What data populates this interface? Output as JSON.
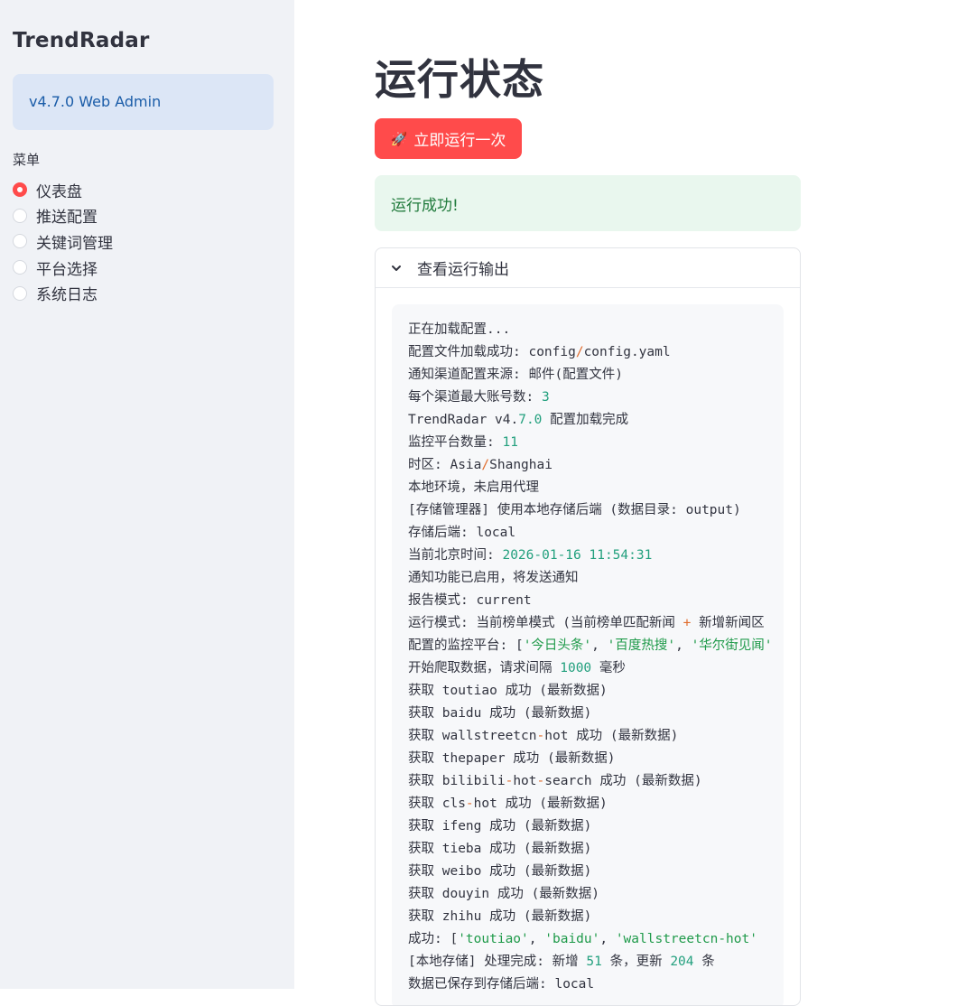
{
  "sidebar": {
    "brand": "TrendRadar",
    "version": "v4.7.0 Web Admin",
    "menu_label": "菜单",
    "items": [
      {
        "label": "仪表盘",
        "selected": true
      },
      {
        "label": "推送配置",
        "selected": false
      },
      {
        "label": "关键词管理",
        "selected": false
      },
      {
        "label": "平台选择",
        "selected": false
      },
      {
        "label": "系统日志",
        "selected": false
      }
    ]
  },
  "main": {
    "title": "运行状态",
    "run_button": {
      "icon": "rocket-icon",
      "label": "立即运行一次"
    },
    "success_message": "运行成功!",
    "expander_title": "查看运行输出",
    "output_lines": [
      [
        [
          "t",
          "正在加载配置..."
        ]
      ],
      [
        [
          "t",
          "配置文件加载成功: config"
        ],
        [
          "o",
          "/"
        ],
        [
          "t",
          "config.yaml"
        ]
      ],
      [
        [
          "t",
          "通知渠道配置来源: 邮件(配置文件)"
        ]
      ],
      [
        [
          "t",
          "每个渠道最大账号数: "
        ],
        [
          "n",
          "3"
        ]
      ],
      [
        [
          "t",
          "TrendRadar v4."
        ],
        [
          "n",
          "7.0"
        ],
        [
          "t",
          " 配置加载完成"
        ]
      ],
      [
        [
          "t",
          "监控平台数量: "
        ],
        [
          "n",
          "11"
        ]
      ],
      [
        [
          "t",
          "时区: Asia"
        ],
        [
          "o",
          "/"
        ],
        [
          "t",
          "Shanghai"
        ]
      ],
      [
        [
          "t",
          "本地环境，未启用代理"
        ]
      ],
      [
        [
          "t",
          "[存储管理器] 使用本地存储后端 (数据目录: output)"
        ]
      ],
      [
        [
          "t",
          "存储后端: local"
        ]
      ],
      [
        [
          "t",
          "当前北京时间: "
        ],
        [
          "n",
          "2026-01-16 11:54:31"
        ]
      ],
      [
        [
          "t",
          "通知功能已启用，将发送通知"
        ]
      ],
      [
        [
          "t",
          "报告模式: current"
        ]
      ],
      [
        [
          "t",
          "运行模式: 当前榜单模式 (当前榜单匹配新闻 "
        ],
        [
          "o",
          "+"
        ],
        [
          "t",
          " 新增新闻区"
        ]
      ],
      [
        [
          "t",
          "配置的监控平台: ["
        ],
        [
          "s",
          "'今日头条'"
        ],
        [
          "t",
          ", "
        ],
        [
          "s",
          "'百度热搜'"
        ],
        [
          "t",
          ", "
        ],
        [
          "s",
          "'华尔街见闻'"
        ]
      ],
      [
        [
          "t",
          "开始爬取数据，请求间隔 "
        ],
        [
          "n",
          "1000"
        ],
        [
          "t",
          " 毫秒"
        ]
      ],
      [
        [
          "t",
          "获取 toutiao 成功 (最新数据)"
        ]
      ],
      [
        [
          "t",
          "获取 baidu 成功 (最新数据)"
        ]
      ],
      [
        [
          "t",
          "获取 wallstreetcn"
        ],
        [
          "o",
          "-"
        ],
        [
          "t",
          "hot 成功 (最新数据)"
        ]
      ],
      [
        [
          "t",
          "获取 thepaper 成功 (最新数据)"
        ]
      ],
      [
        [
          "t",
          "获取 bilibili"
        ],
        [
          "o",
          "-"
        ],
        [
          "t",
          "hot"
        ],
        [
          "o",
          "-"
        ],
        [
          "t",
          "search 成功 (最新数据)"
        ]
      ],
      [
        [
          "t",
          "获取 cls"
        ],
        [
          "o",
          "-"
        ],
        [
          "t",
          "hot 成功 (最新数据)"
        ]
      ],
      [
        [
          "t",
          "获取 ifeng 成功 (最新数据)"
        ]
      ],
      [
        [
          "t",
          "获取 tieba 成功 (最新数据)"
        ]
      ],
      [
        [
          "t",
          "获取 weibo 成功 (最新数据)"
        ]
      ],
      [
        [
          "t",
          "获取 douyin 成功 (最新数据)"
        ]
      ],
      [
        [
          "t",
          "获取 zhihu 成功 (最新数据)"
        ]
      ],
      [
        [
          "t",
          "成功: ["
        ],
        [
          "s",
          "'toutiao'"
        ],
        [
          "t",
          ", "
        ],
        [
          "s",
          "'baidu'"
        ],
        [
          "t",
          ", "
        ],
        [
          "s",
          "'wallstreetcn-hot'"
        ]
      ],
      [
        [
          "t",
          "[本地存储] 处理完成: 新增 "
        ],
        [
          "n",
          "51"
        ],
        [
          "t",
          " 条，更新 "
        ],
        [
          "n",
          "204"
        ],
        [
          "t",
          " 条"
        ]
      ],
      [
        [
          "t",
          "数据已保存到存储后端: local"
        ]
      ]
    ]
  }
}
